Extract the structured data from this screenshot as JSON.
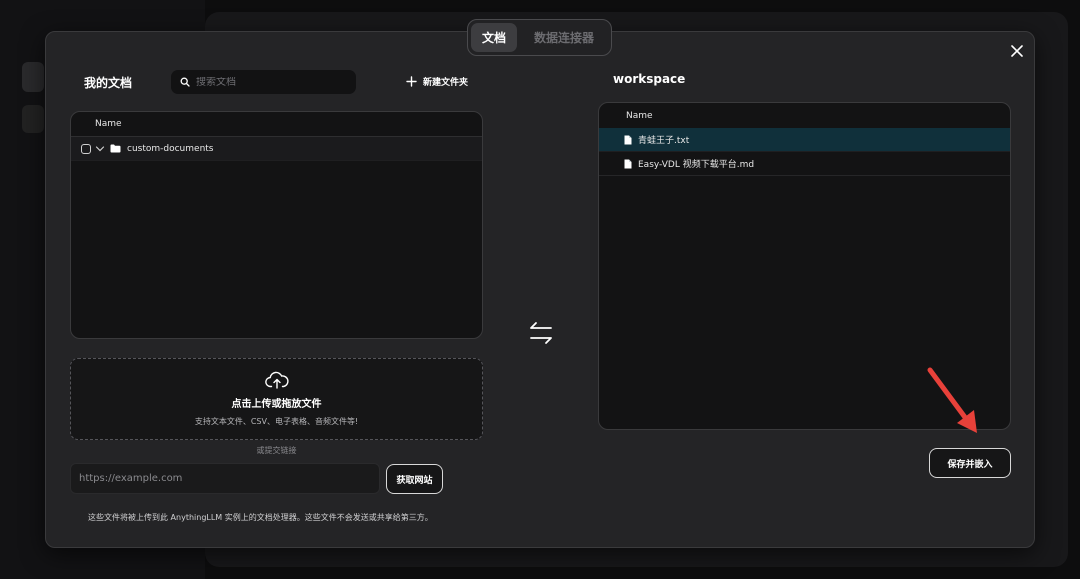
{
  "tabs": [
    {
      "label": "文档",
      "active": true
    },
    {
      "label": "数据连接器",
      "active": false
    }
  ],
  "my_documents": {
    "title": "我的文档",
    "search_placeholder": "搜索文档",
    "new_folder_label": "新建文件夹",
    "table": {
      "header": "Name",
      "rows": [
        {
          "name": "custom-documents",
          "type": "folder",
          "expanded": true,
          "checked": false
        }
      ]
    }
  },
  "upload": {
    "title": "点击上传或拖放文件",
    "subtitle": "支持文本文件、CSV、电子表格、音频文件等!",
    "or_link_label": "或提交链接",
    "url_placeholder": "https://example.com",
    "fetch_button": "获取网站"
  },
  "footnote": "这些文件将被上传到此 AnythingLLM 实例上的文档处理器。这些文件不会发送或共享给第三方。",
  "workspace": {
    "title": "workspace",
    "table": {
      "header": "Name",
      "rows": [
        {
          "name": "青蛙王子.txt",
          "type": "file",
          "selected": true
        },
        {
          "name": "Easy-VDL 视频下载平台.md",
          "type": "file",
          "selected": false
        }
      ]
    }
  },
  "save_button": "保存并嵌入",
  "colors": {
    "modal_bg": "#242426",
    "selected_row": "#10303b",
    "annotation_arrow": "#e8413a"
  },
  "icons": [
    "close-icon",
    "search-icon",
    "plus-icon",
    "checkbox-icon",
    "chevron-down-icon",
    "folder-icon",
    "upload-cloud-icon",
    "swap-arrows-icon",
    "file-icon"
  ]
}
